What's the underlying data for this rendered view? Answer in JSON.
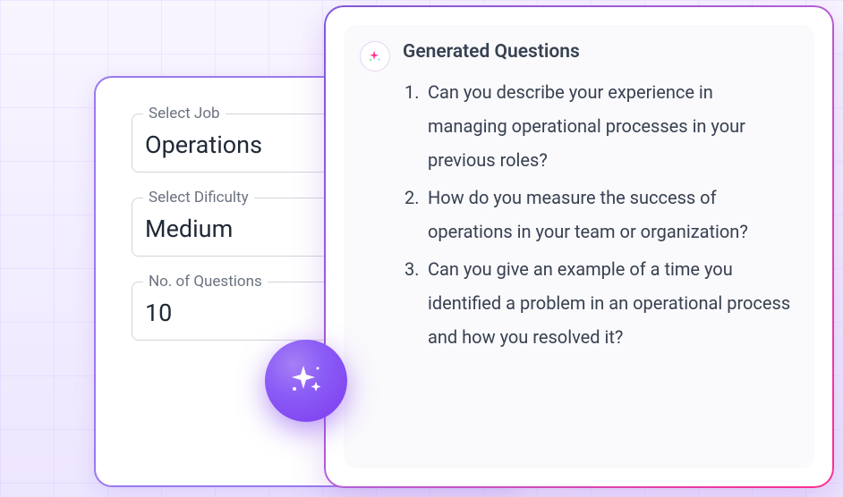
{
  "form": {
    "job": {
      "label": "Select Job",
      "value": "Operations"
    },
    "difficulty": {
      "label": "Select Dificulty",
      "value": "Medium"
    },
    "count": {
      "label": "No. of Questions",
      "value": "10"
    }
  },
  "output": {
    "title": "Generated Questions",
    "questions": [
      "Can you describe your experience in managing operational processes in your previous roles?",
      "How do you measure the success of operations in your team or organization?",
      "Can you give an example of a time you identified a problem in an operational process and how you resolved it?"
    ]
  }
}
